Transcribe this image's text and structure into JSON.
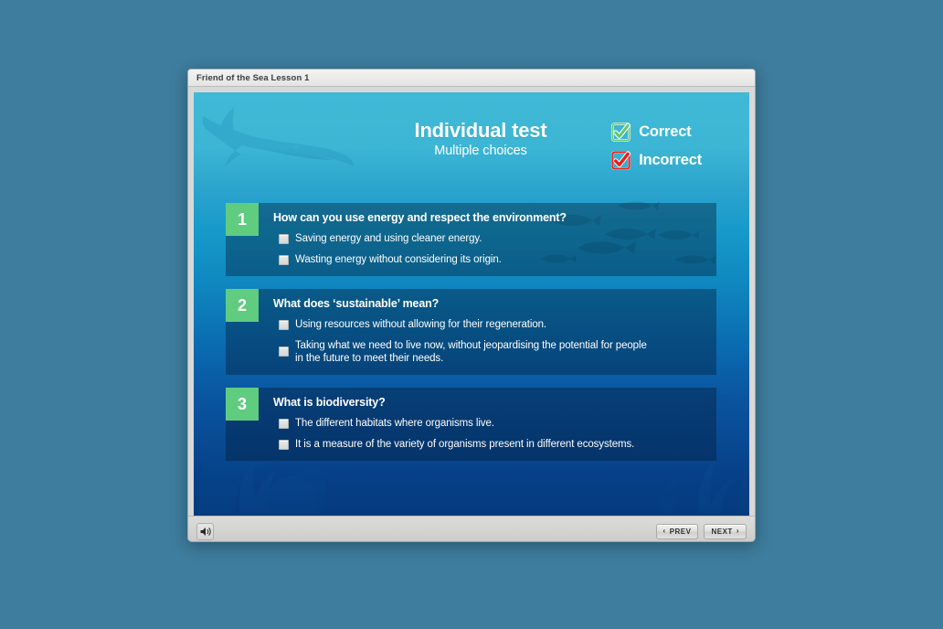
{
  "window": {
    "titlebar_title": "Friend of the Sea Lesson 1"
  },
  "slide": {
    "title_main": "Individual test",
    "title_sub": "Multiple choices",
    "legend": [
      {
        "icon": "checkbox-checked-green-icon",
        "label": "Correct",
        "color": "#63c877"
      },
      {
        "icon": "checkbox-checked-red-icon",
        "label": "Incorrect",
        "color": "#e8201c"
      }
    ],
    "questions": [
      {
        "number": "1",
        "text": "How can you use energy and respect the environment?",
        "options": [
          "Saving energy and using cleaner energy.",
          "Wasting energy without considering its origin."
        ]
      },
      {
        "number": "2",
        "text": "What does ‘sustainable’ mean?",
        "options": [
          "Using resources without allowing for their regeneration.",
          "Taking what we need to live now, without jeopardising the potential for people in the future to meet their needs."
        ]
      },
      {
        "number": "3",
        "text": "What is biodiversity?",
        "options": [
          "The different habitats where organisms live.",
          "It is a measure of the variety of organisms present in different ecosystems."
        ]
      }
    ]
  },
  "footer": {
    "sound_icon": "speaker-icon",
    "prev_label": "PREV",
    "next_label": "NEXT",
    "prev_chevron": "‹",
    "next_chevron": "›"
  },
  "colors": {
    "badge_green": "#5fcc80",
    "header_cyan": "#3fb9d6",
    "deep_navy": "#053a7e",
    "page_background": "#3e7d9e",
    "correct_green": "#63c877",
    "incorrect_red": "#e8201c"
  }
}
